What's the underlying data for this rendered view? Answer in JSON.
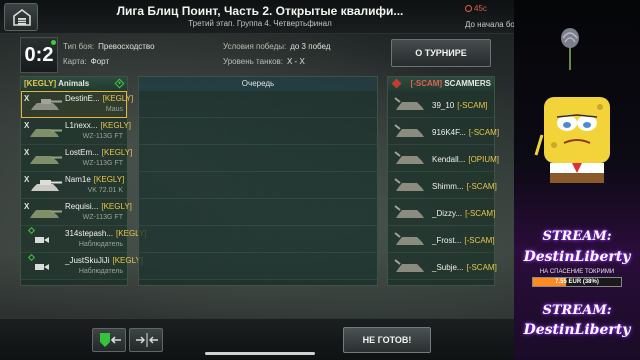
{
  "header": {
    "title": "Лига Блиц Поинт, Часть 2. Открытые квалифи...",
    "subtitle": "Третий этап. Группа 4. Четвертьфинал",
    "timer": "45с",
    "start_label": "До начала боя"
  },
  "info": {
    "score": "0:2",
    "battle_type_label": "Тип боя:",
    "battle_type_value": "Превосходство",
    "map_label": "Карта:",
    "map_value": "Форт",
    "victory_label": "Условия победы:",
    "victory_value": "до 3 побед",
    "tier_label": "Уровень танков:",
    "tier_value": "X - X",
    "tournament_button": "О ТУРНИРЕ"
  },
  "left_team": {
    "clan_tag": "[KEGLY]",
    "team_name": "Animals",
    "players": [
      {
        "mark": "X",
        "name": "DestinE...",
        "clan": "[KEGLY]",
        "tank": "Maus"
      },
      {
        "mark": "X",
        "name": "L1nexx...",
        "clan": "[KEGLY]",
        "tank": "WZ-113G FT"
      },
      {
        "mark": "X",
        "name": "LostEm...",
        "clan": "[KEGLY]",
        "tank": "WZ-113G FT"
      },
      {
        "mark": "X",
        "name": "Nam1e",
        "clan": "[KEGLY]",
        "tank": "VK 72.01 K"
      },
      {
        "mark": "X",
        "name": "Requisi...",
        "clan": "[KEGLY]",
        "tank": "WZ-113G FT"
      },
      {
        "mark": "",
        "name": "314stepash...",
        "clan": "[KEGLY]",
        "tank": "Наблюдатель"
      },
      {
        "mark": "",
        "name": "_JustSkuJiJi",
        "clan": "[KEGLY]",
        "tank": "Наблюдатель"
      }
    ]
  },
  "queue": {
    "title": "Очередь"
  },
  "right_team": {
    "clan_tag": "[-SCAM]",
    "team_name": "SCAMMERS",
    "players": [
      {
        "name": "39_10",
        "clan": "[-SCAM]"
      },
      {
        "name": "916K4F...",
        "clan": "[-SCAM]"
      },
      {
        "name": "Kendall...",
        "clan": "[OPIUM]"
      },
      {
        "name": "Shimm...",
        "clan": "[-SCAM]"
      },
      {
        "name": "_Dizzy...",
        "clan": "[-SCAM]"
      },
      {
        "name": "_Frost...",
        "clan": "[-SCAM]"
      },
      {
        "name": "_Subje...",
        "clan": "[-SCAM]"
      }
    ]
  },
  "bottom": {
    "not_ready_button": "НЕ ГОТОВ!"
  },
  "stream": {
    "label": "STREAM:",
    "name": "DestinLiberty",
    "subtitle": "НА СПАСЕНИЕ ТОКРИМИ",
    "donation_text": "7.55 EUR (38%)",
    "donation_progress": 0.38,
    "accent_color": "#b040ff",
    "bar_color": "#ff8a1f"
  }
}
